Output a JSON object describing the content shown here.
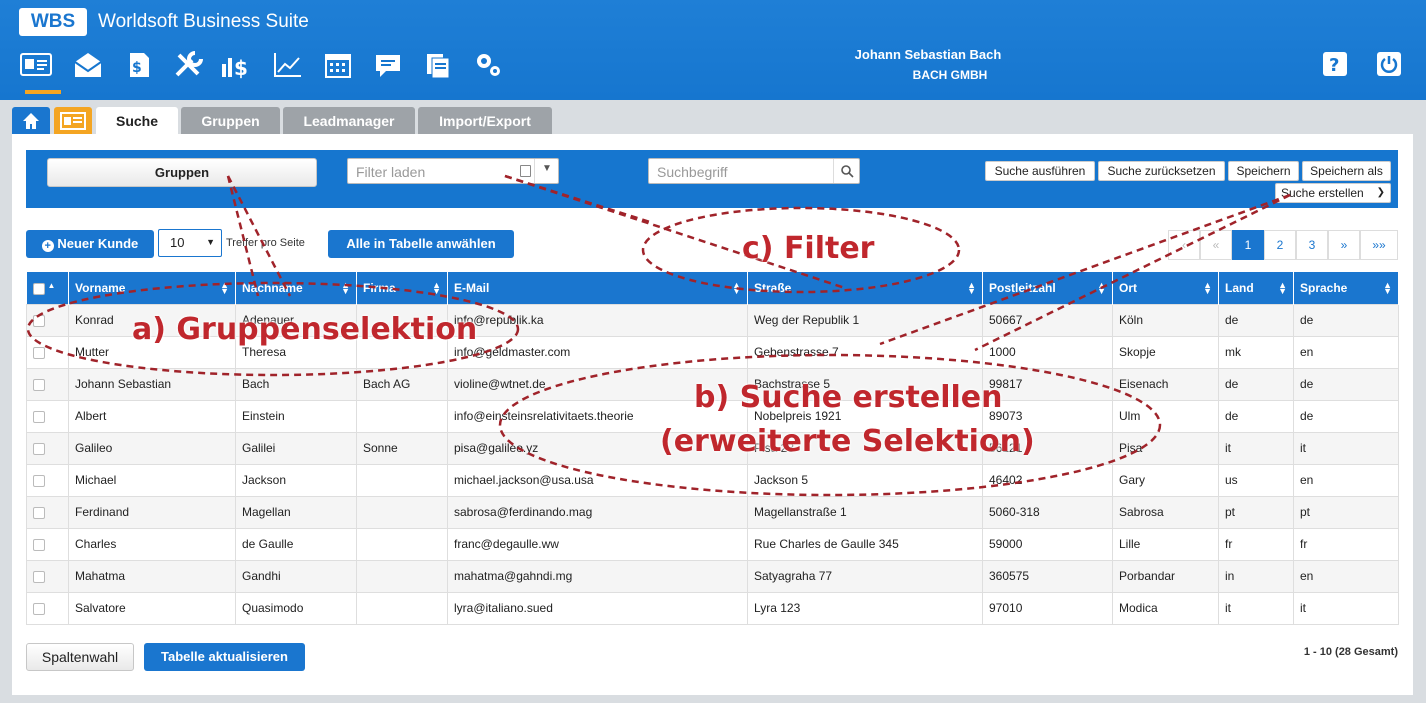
{
  "header": {
    "logo": "WBS",
    "suite_title": "Worldsoft Business Suite",
    "user_name": "Johann Sebastian Bach",
    "company": "BACH GMBH",
    "nav_icons": [
      "contacts-card-icon",
      "mail-icon",
      "invoice-icon",
      "tools-icon",
      "shop-dollar-icon",
      "chart-icon",
      "calendar-icon",
      "chat-icon",
      "documents-icon",
      "settings-gears-icon"
    ],
    "right_icons": [
      "help-icon",
      "power-icon"
    ],
    "accent_color": "#f4a522",
    "brand_color": "#1676cf"
  },
  "tabs": [
    {
      "label": ""
    },
    {
      "label": ""
    },
    {
      "label": "Suche"
    },
    {
      "label": "Gruppen"
    },
    {
      "label": "Leadmanager"
    },
    {
      "label": "Import/Export"
    }
  ],
  "toolbar": {
    "groups_button": "Gruppen",
    "filter_placeholder": "Filter laden",
    "search_placeholder": "Suchbegriff",
    "run_search": "Suche ausführen",
    "reset_search": "Suche zurücksetzen",
    "save": "Speichern",
    "save_as": "Speichern als",
    "create_search": "Suche erstellen"
  },
  "actions": {
    "new_customer": "Neuer Kunde",
    "per_page_value": "10",
    "per_page_label": "Treffer pro Seite",
    "select_all": "Alle in Tabelle anwählen"
  },
  "pager": {
    "first": "‹",
    "prev": "«",
    "pages": [
      "1",
      "2",
      "3"
    ],
    "next": "»",
    "last": "»»",
    "current": "1"
  },
  "table": {
    "columns": [
      "Vorname",
      "Nachname",
      "Firma",
      "E-Mail",
      "Straße",
      "Postleitzahl",
      "Ort",
      "Land",
      "Sprache"
    ],
    "rows": [
      [
        "Konrad",
        "Adenauer",
        "",
        "info@republik.ka",
        "Weg der Republik 1",
        "50667",
        "Köln",
        "de",
        "de"
      ],
      [
        "Mutter",
        "Theresa",
        "",
        "info@geldmaster.com",
        "Gebenstrasse 7",
        "1000",
        "Skopje",
        "mk",
        "en"
      ],
      [
        "Johann Sebastian",
        "Bach",
        "Bach AG",
        "violine@wtnet.de",
        "Bachstrasse 5",
        "99817",
        "Eisenach",
        "de",
        "de"
      ],
      [
        "Albert",
        "Einstein",
        "",
        "info@einsteinsrelativitaets.theorie",
        "Nobelpreis 1921",
        "89073",
        "Ulm",
        "de",
        "de"
      ],
      [
        "Galileo",
        "Galilei",
        "Sonne",
        "pisa@galileo.yz",
        "Pisa 23",
        "56121",
        "Pisa",
        "it",
        "it"
      ],
      [
        "Michael",
        "Jackson",
        "",
        "michael.jackson@usa.usa",
        "Jackson 5",
        "46402",
        "Gary",
        "us",
        "en"
      ],
      [
        "Ferdinand",
        "Magellan",
        "",
        "sabrosa@ferdinando.mag",
        "Magellanstraße 1",
        "5060-318",
        "Sabrosa",
        "pt",
        "pt"
      ],
      [
        "Charles",
        "de Gaulle",
        "",
        "franc@degaulle.ww",
        "Rue Charles de Gaulle 345",
        "59000",
        "Lille",
        "fr",
        "fr"
      ],
      [
        "Mahatma",
        "Gandhi",
        "",
        "mahatma@gahndi.mg",
        "Satyagraha 77",
        "360575",
        "Porbandar",
        "in",
        "en"
      ],
      [
        "Salvatore",
        "Quasimodo",
        "",
        "lyra@italiano.sued",
        "Lyra 123",
        "97010",
        "Modica",
        "it",
        "it"
      ]
    ]
  },
  "footer": {
    "column_choice": "Spaltenwahl",
    "refresh_table": "Tabelle aktualisieren",
    "info": "1 - 10 (28 Gesamt)"
  },
  "annotations": {
    "a": "a) Gruppenselektion",
    "b1": "b) Suche erstellen",
    "b2": "(erweiterte Selektion)",
    "c": "c) Filter",
    "color": "#c0272d"
  }
}
